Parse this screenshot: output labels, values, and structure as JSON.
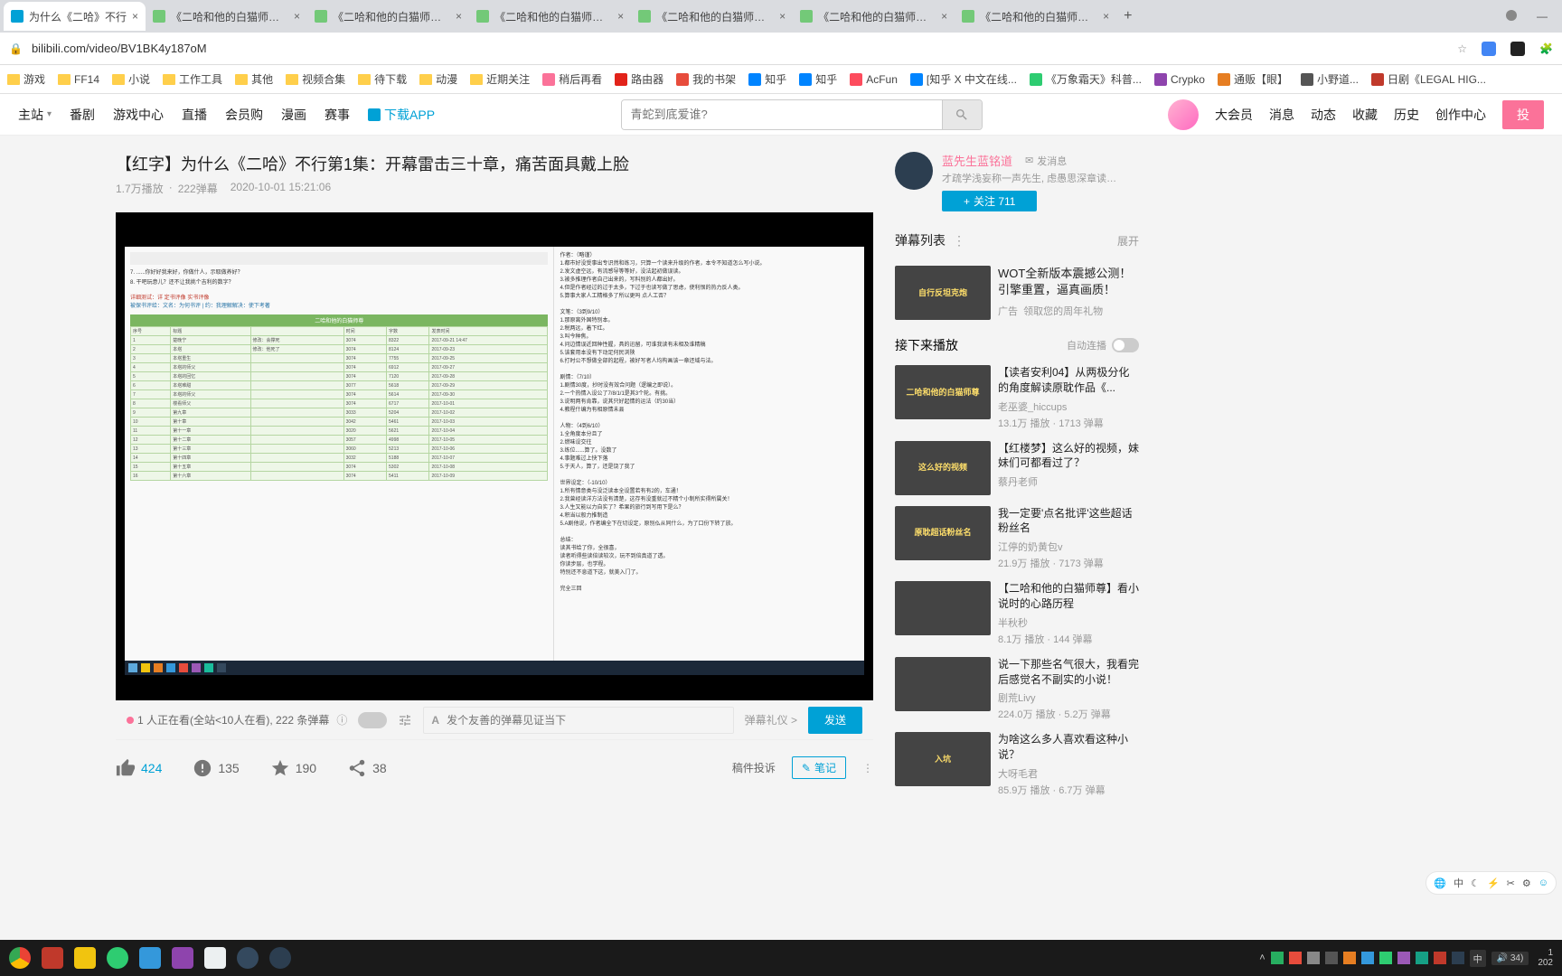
{
  "browser": {
    "tabs": [
      {
        "title": "为什么《二哈》不行",
        "active": true,
        "fav": "bili"
      },
      {
        "title": "《二哈和他的白猫师尊》肉包不..."
      },
      {
        "title": "《二哈和他的白猫师尊》肉包不..."
      },
      {
        "title": "《二哈和他的白猫师尊》肉包不..."
      },
      {
        "title": "《二哈和他的白猫师尊》肉包不..."
      },
      {
        "title": "《二哈和他的白猫师尊》肉包不..."
      },
      {
        "title": "《二哈和他的白猫师尊》肉包不..."
      }
    ],
    "url": "bilibili.com/video/BV1BK4y187oM",
    "bookmarks": [
      "游戏",
      "FF14",
      "小说",
      "工作工具",
      "其他",
      "视频合集",
      "待下载",
      "动漫",
      "近期关注",
      "稍后再看",
      "路由器",
      "我的书架",
      "知乎",
      "知乎",
      "AcFun",
      "[知乎 X 中文在线...",
      "《万象霜天》科普...",
      "Crypko",
      "通贩【眼】",
      "小野道...",
      "日剧《LEGAL HIG..."
    ]
  },
  "nav": {
    "left": [
      "主站",
      "番剧",
      "游戏中心",
      "直播",
      "会员购",
      "漫画",
      "赛事"
    ],
    "download": "下载APP",
    "search_placeholder": "青蛇到底爱谁?",
    "right": [
      "大会员",
      "消息",
      "动态",
      "收藏",
      "历史",
      "创作中心"
    ],
    "upload": "投"
  },
  "video": {
    "title": "【红字】为什么《二哈》不行第1集：开幕雷击三十章，痛苦面具戴上脸",
    "plays": "1.7万播放",
    "danmu": "222弹幕",
    "date": "2020-10-01 15:21:06"
  },
  "toolbar": {
    "watching": "1 人正在看(全站<10人在看), 222 条弹幕",
    "danmu_placeholder": "发个友善的弹幕见证当下",
    "gift": "弹幕礼仪 >",
    "send": "发送"
  },
  "actions": {
    "like": "424",
    "coin": "135",
    "fav": "190",
    "share": "38",
    "report": "稿件投诉",
    "note": "笔记"
  },
  "up": {
    "name": "蓝先生蓝铭道",
    "msg": "发消息",
    "sign": "才疏学浅妄称一声先生, 虑愚思深章读八斗文...",
    "follow": "关注 711"
  },
  "danmulist": {
    "title": "弹幕列表",
    "expand": "展开"
  },
  "ad": {
    "title": "WOT全新版本震撼公测！引擎重置，逼真画质！",
    "thumb": "自行反坦克炮",
    "tag": "广告",
    "link": "领取您的周年礼物"
  },
  "nextplay": {
    "label": "接下来播放",
    "autoplay": "自动连播"
  },
  "recs": [
    {
      "title": "【读者安利04】从两极分化的角度解读原耽作品《...",
      "up": "老巫婆_hiccups",
      "stats": "13.1万 播放 · 1713 弹幕",
      "thumb": "二哈和他的白猫师尊"
    },
    {
      "title": "【红楼梦】这么好的视频，妹妹们可都看过了？",
      "up": "蔡丹老师",
      "stats": "",
      "thumb": "这么好的视频"
    },
    {
      "title": "我一定要'点名批评'这些超话粉丝名",
      "up": "江停的奶黄包v",
      "stats": "21.9万 播放 · 7173 弹幕",
      "thumb": "原耽超话粉丝名"
    },
    {
      "title": "【二哈和他的白猫师尊】看小说时的心路历程",
      "up": "半秋秒",
      "stats": "8.1万 播放 · 144 弹幕",
      "thumb": ""
    },
    {
      "title": "说一下那些名气很大，我看完后感觉名不副实的小说！",
      "up": "剧荒Livy",
      "stats": "224.0万 播放 · 5.2万 弹幕",
      "thumb": ""
    },
    {
      "title": "为啥这么多人喜欢看这种小说？",
      "up": "大呀毛君",
      "stats": "85.9万 播放 · 6.7万 弹幕",
      "thumb": "入坑"
    }
  ],
  "sidefloat": "中",
  "taskbar": {
    "ime": "中",
    "vol": "34)",
    "time": "1",
    "date": "202"
  }
}
